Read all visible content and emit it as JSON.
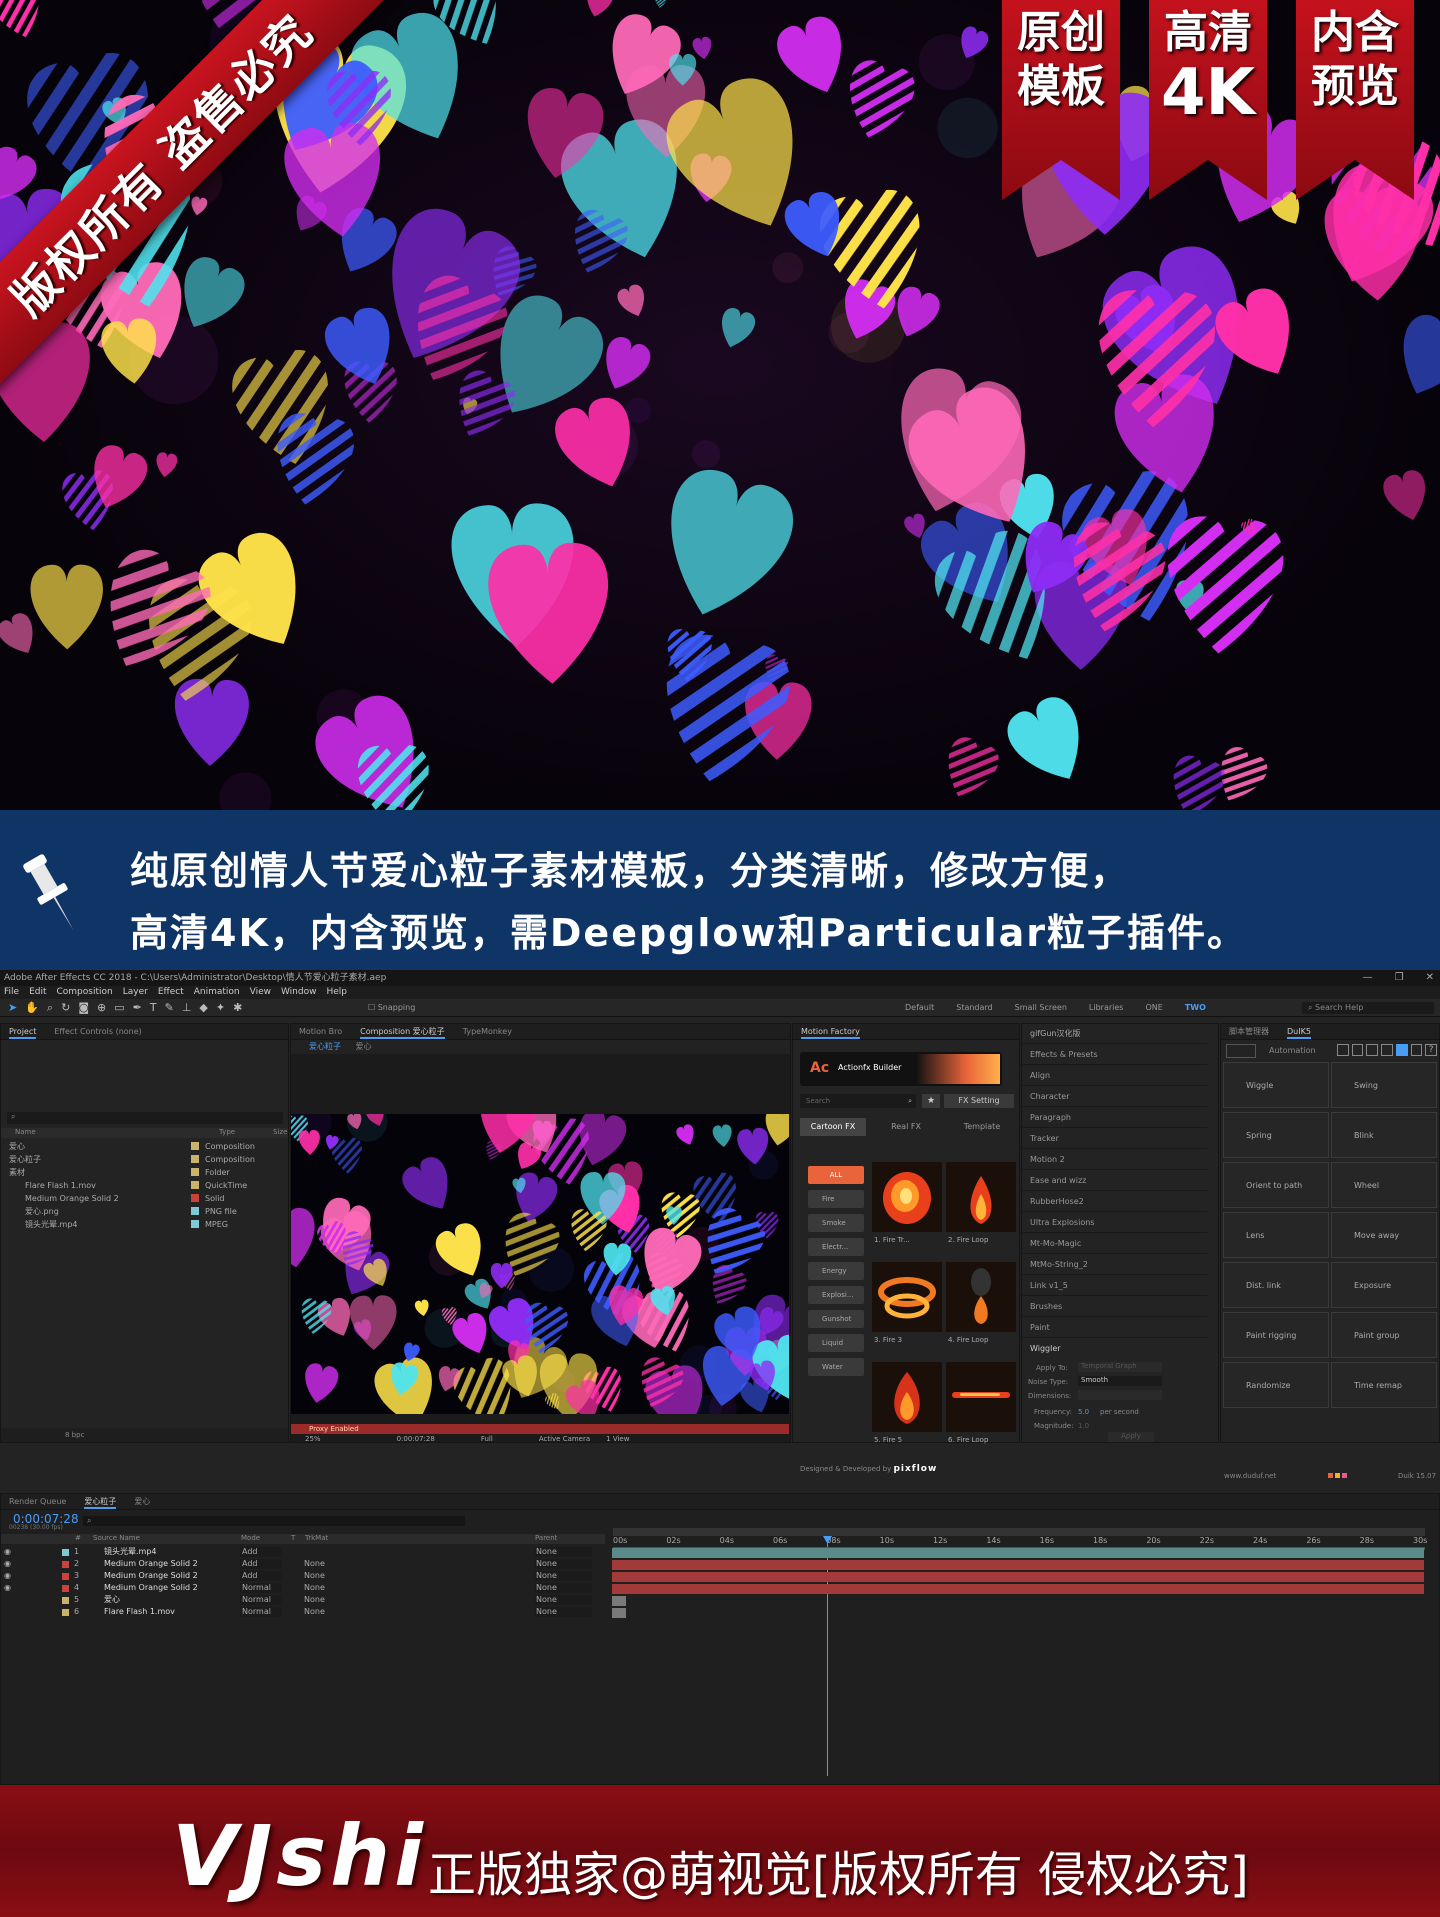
{
  "hero": {
    "diagonal_banner": "版权所有 盗售必究",
    "ribbons": [
      {
        "line1": "原创",
        "line2": "模板"
      },
      {
        "line1": "高清",
        "line2": "4K"
      },
      {
        "line1": "内含",
        "line2": "预览"
      }
    ],
    "heart_colors": [
      "#ff2fa8",
      "#d22df0",
      "#3d5cff",
      "#4fe3ee",
      "#ffe34a",
      "#ff6ab8",
      "#8e2cf5"
    ]
  },
  "info": {
    "line1": "纯原创情人节爱心粒子素材模板，分类清晰，修改方便，",
    "line2": "高清4K，内含预览，需Deepglow和Particular粒子插件。"
  },
  "ae": {
    "window_title": "Adobe After Effects CC 2018 - C:\\Users\\Administrator\\Desktop\\情人节爱心粒子素材.aep",
    "menu": [
      "File",
      "Edit",
      "Composition",
      "Layer",
      "Effect",
      "Animation",
      "View",
      "Window",
      "Help"
    ],
    "snapping": "Snapping",
    "workspaces": [
      "Default",
      "Standard",
      "Small Screen",
      "Libraries",
      "ONE",
      "TWO"
    ],
    "search_help": "Search Help",
    "project_tabs": [
      "Project",
      "Effect Controls (none)"
    ],
    "project_cols": [
      "Name",
      "Type",
      "Size"
    ],
    "project_items": [
      {
        "name": "爱心",
        "type": "Composition",
        "color": "#c9b36a"
      },
      {
        "name": "爱心粒子",
        "type": "Composition",
        "color": "#c9b36a"
      },
      {
        "name": "素材",
        "type": "Folder",
        "color": "#c9b36a"
      },
      {
        "name": "Flare Flash 1.mov",
        "type": "QuickTime",
        "color": "#c9b36a"
      },
      {
        "name": "Medium Orange Solid 2",
        "type": "Solid",
        "color": "#c9433a"
      },
      {
        "name": "爱心.png",
        "type": "PNG file",
        "color": "#7fc9d6"
      },
      {
        "name": "镜头光晕.mp4",
        "type": "MPEG",
        "color": "#7fc9d6"
      }
    ],
    "project_bpc": "8 bpc",
    "comp_tabs": [
      "Motion Bro",
      "Composition 爱心粒子",
      "TypeMonkey"
    ],
    "comp_crumbs": [
      "爱心粒子",
      "爱心"
    ],
    "proxy_warning": "Proxy Enabled",
    "viewer_zoom": "25%",
    "viewer_time": "0:00:07:28",
    "viewer_res": "Full",
    "viewer_camera": "Active Camera",
    "viewer_views": "1 View",
    "motion_factory": {
      "tab": "Motion Factory",
      "product": "Actionfx Builder",
      "search_placeholder": "Search",
      "fx_setting": "FX Setting",
      "tabs": [
        "Cartoon FX",
        "Real FX",
        "Template"
      ],
      "categories": [
        "ALL",
        "Fire",
        "Smoke",
        "Electr...",
        "Energy",
        "Explosi...",
        "Gunshot",
        "Liquid",
        "Water"
      ],
      "items": [
        "1. Fire Tr...",
        "2. Fire Loop",
        "3. Fire 3",
        "4. Fire Loop",
        "5. Fire 5",
        "6. Fire Loop"
      ],
      "credit": "Designed & Developed by",
      "credit_brand": "pixflow"
    },
    "effects_list": [
      "gifGun汉化版",
      "Effects & Presets",
      "Align",
      "Character",
      "Paragraph",
      "Tracker",
      "Motion 2",
      "Ease and wizz",
      "RubberHose2",
      "Ultra Explosions",
      "Mt-Mo-Magic",
      "MtMo-String_2",
      "Link v1_5",
      "Brushes",
      "Paint"
    ],
    "wiggler": {
      "title": "Wiggler",
      "apply_to_label": "Apply To:",
      "apply_to_value": "Temporal Graph",
      "noise_label": "Noise Type:",
      "noise_value": "Smooth",
      "dimensions_label": "Dimensions:",
      "frequency_label": "Frequency:",
      "frequency_value": "5.0",
      "frequency_unit": "per second",
      "magnitude_label": "Magnitude:",
      "magnitude_value": "1.0",
      "apply_button": "Apply"
    },
    "duik": {
      "tabs": [
        "脚本管理器",
        "DuIK5"
      ],
      "automation": "Automation",
      "buttons": [
        "Wiggle",
        "Swing",
        "Spring",
        "Blink",
        "Orient to path",
        "Wheel",
        "Lens",
        "Move away",
        "Dist. link",
        "Exposure",
        "Paint rigging",
        "Paint group",
        "Randomize",
        "Time remap"
      ],
      "site": "www.duduf.net",
      "version": "Duik 15.07"
    },
    "timeline": {
      "tabs": [
        "Render Queue",
        "爱心粒子",
        "爱心"
      ],
      "current_time": "0:00:07:28",
      "fps_info": "00238 (30.00 fps)",
      "cols": [
        "#",
        "Source Name",
        "Mode",
        "T",
        "TrkMat",
        "Parent"
      ],
      "ruler": [
        "00s",
        "02s",
        "04s",
        "06s",
        "08s",
        "10s",
        "12s",
        "14s",
        "16s",
        "18s",
        "20s",
        "22s",
        "24s",
        "26s",
        "28s",
        "30s"
      ],
      "layers": [
        {
          "num": "1",
          "name": "镜头光晕.mp4",
          "mode": "Add",
          "trkmat": "",
          "parent": "None",
          "color": "#7fc9d6"
        },
        {
          "num": "2",
          "name": "Medium Orange Solid 2",
          "mode": "Add",
          "trkmat": "None",
          "parent": "None",
          "color": "#c9433a"
        },
        {
          "num": "3",
          "name": "Medium Orange Solid 2",
          "mode": "Add",
          "trkmat": "None",
          "parent": "None",
          "color": "#c9433a"
        },
        {
          "num": "4",
          "name": "Medium Orange Solid 2",
          "mode": "Normal",
          "trkmat": "None",
          "parent": "None",
          "color": "#c9433a"
        },
        {
          "num": "5",
          "name": "爱心",
          "mode": "Normal",
          "trkmat": "None",
          "parent": "None",
          "color": "#c9b36a"
        },
        {
          "num": "6",
          "name": "Flare Flash 1.mov",
          "mode": "Normal",
          "trkmat": "None",
          "parent": "None",
          "color": "#c9b36a"
        }
      ]
    }
  },
  "footer": {
    "brand": "VJshi",
    "slogan": "正版独家@萌视觉[版权所有 侵权必究]"
  }
}
